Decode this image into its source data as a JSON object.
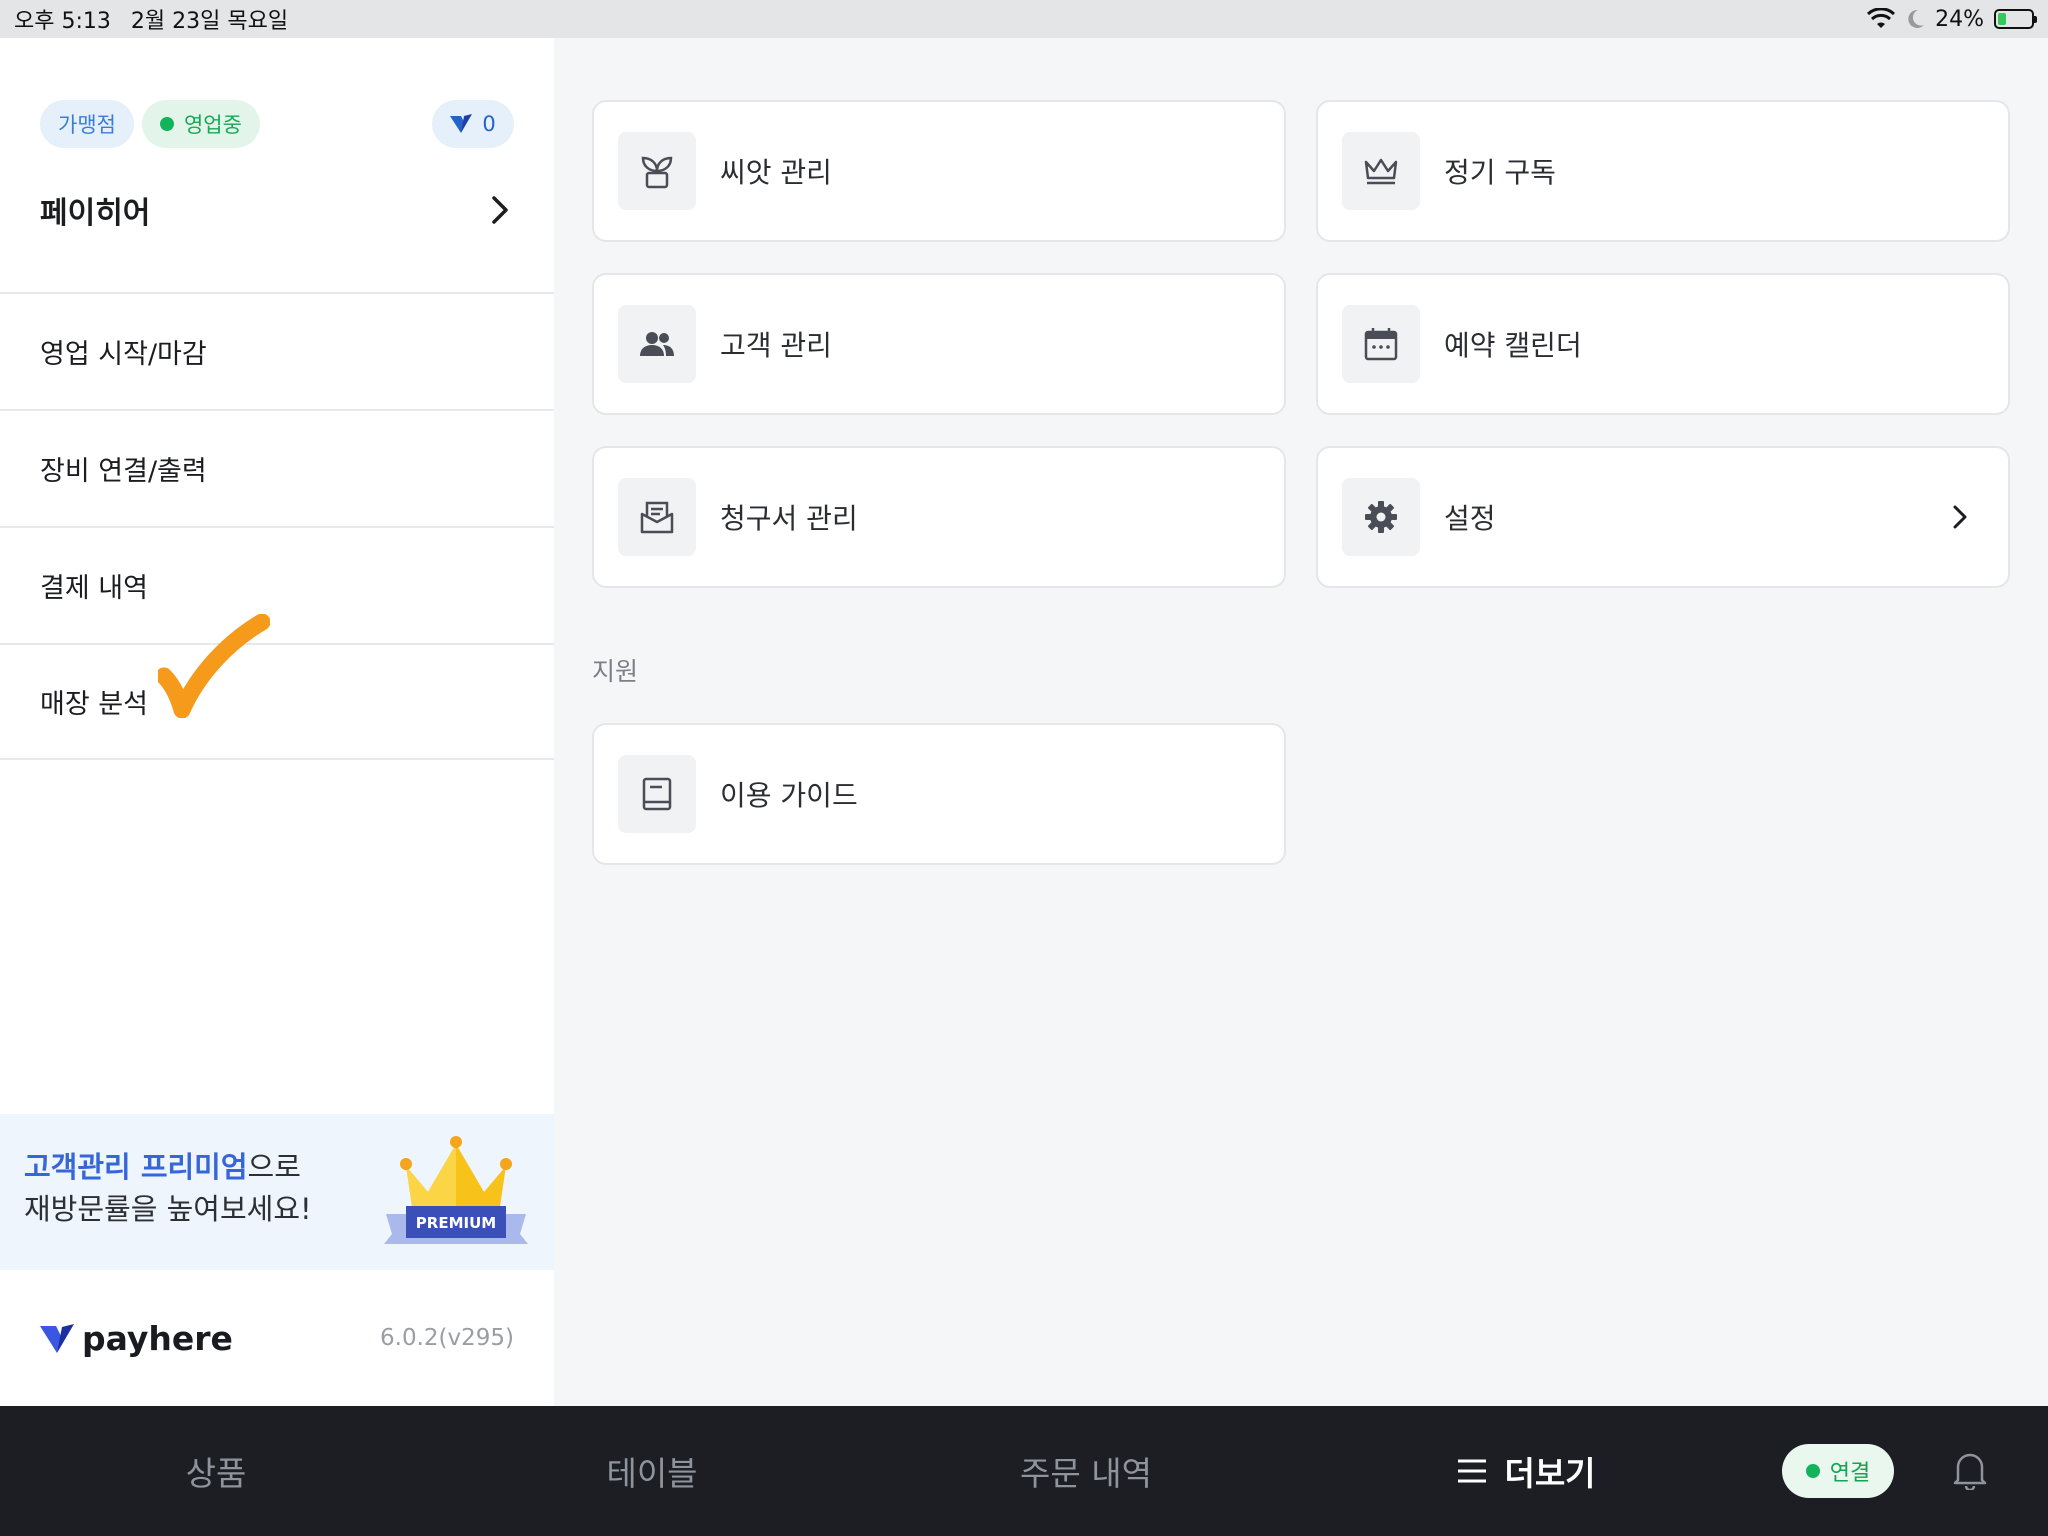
{
  "status_bar": {
    "time": "오후 5:13",
    "date": "2월 23일 목요일",
    "battery": "24%",
    "battery_level": 0.24
  },
  "sidebar": {
    "badges": {
      "franchise": "가맹점",
      "open": "영업중",
      "points": "0"
    },
    "store_name": "페이히어",
    "menu": [
      {
        "label": "영업 시작/마감"
      },
      {
        "label": "장비 연결/출력"
      },
      {
        "label": "결제 내역"
      },
      {
        "label": "매장 분석"
      }
    ],
    "promo": {
      "highlight": "고객관리 프리미엄",
      "line1_rest": "으로",
      "line2": "재방문률을 높여보세요!",
      "badge": "PREMIUM"
    },
    "brand": "payhere",
    "version": "6.0.2(v295)"
  },
  "main": {
    "cards": [
      {
        "label": "씨앗 관리",
        "icon": "sprout-icon"
      },
      {
        "label": "정기 구독",
        "icon": "crown-icon"
      },
      {
        "label": "고객 관리",
        "icon": "people-icon"
      },
      {
        "label": "예약 캘린더",
        "icon": "calendar-icon"
      },
      {
        "label": "청구서 관리",
        "icon": "envelope-icon"
      },
      {
        "label": "설정",
        "icon": "gear-icon"
      }
    ],
    "support_title": "지원",
    "support_cards": [
      {
        "label": "이용 가이드",
        "icon": "book-icon"
      }
    ]
  },
  "bottom_nav": {
    "tabs": [
      "상품",
      "테이블",
      "주문 내역",
      "더보기"
    ],
    "active_tab": "더보기",
    "connect": "연결"
  },
  "colors": {
    "accent_blue": "#3766d8",
    "green": "#13b35c",
    "nav_bg": "#1c1e24",
    "check_orange": "#f59a1b"
  }
}
